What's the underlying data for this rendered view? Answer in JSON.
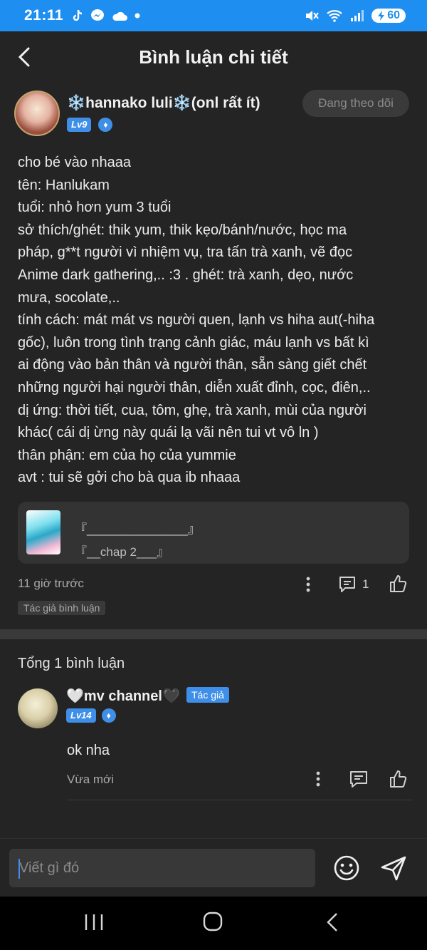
{
  "status_bar": {
    "time": "21:11",
    "battery": "60"
  },
  "header": {
    "title": "Bình luận chi tiết"
  },
  "post": {
    "author": "❄️hannako luli❄️(onl rất ít)",
    "level": "Lv9",
    "follow_label": "Đang theo dõi",
    "body_lines": [
      "cho bé vào nhaaa",
      "tên: Hanlukam",
      "tuổi: nhỏ hơn yum 3 tuổi",
      "sở thích/ghét: thik yum, thik kẹo/bánh/nước, học ma",
      "pháp, g**t người vì nhiệm vụ, tra tấn trà xanh, vẽ đọc",
      "Anime dark gathering,.. :3   . ghét: trà xanh, dẹo, nước",
      "mưa, socolate,..",
      "tính cách: mát mát vs người quen, lạnh vs hiha aut(-hiha",
      "gốc), luôn trong tình trạng cảnh giác, máu lạnh vs bất kì",
      "ai động vào bản thân và người thân, sẵn sàng giết chết",
      "những người hại người thân, diễn xuất đỉnh, cọc, điên,..",
      "dị ứng: thời tiết, cua, tôm, ghẹ, trà xanh, mùi của người",
      "khác( cái dị ừng này quái lạ vãi nên tui vt vô ln )",
      "thân phận: em của họ của yummie",
      "avt : tui sẽ gởi cho bà qua ib nhaaa"
    ],
    "attachment": {
      "title": "『_______________』",
      "subtitle": "『__chap 2___』"
    },
    "time": "11 giờ trước",
    "comment_count": "1",
    "author_tag": "Tác giả bình luận"
  },
  "comments": {
    "total_label": "Tổng 1 bình luận",
    "items": [
      {
        "author": "🤍mv channel🖤",
        "badge": "Tác giả",
        "level": "Lv14",
        "text": "ok nha",
        "time": "Vừa mới"
      }
    ]
  },
  "composer": {
    "placeholder": "Viết gì đó"
  }
}
